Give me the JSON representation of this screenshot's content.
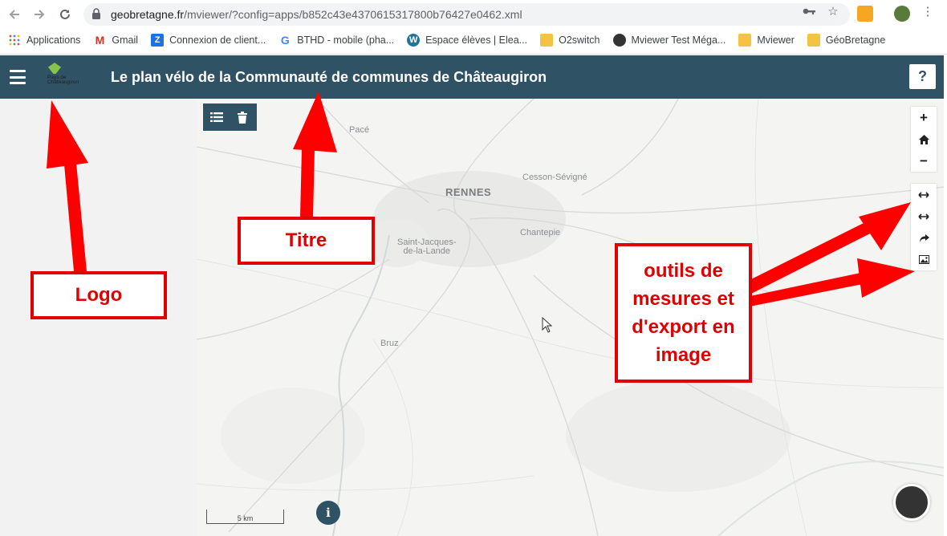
{
  "browser": {
    "url_host": "geobretagne.fr",
    "url_path": "/mviewer/?config=apps/b852c43e4370615317800b76427e0462.xml",
    "bookmarks": [
      {
        "label": "Applications",
        "icon": "apps-grid-icon",
        "color": "#4285f4"
      },
      {
        "label": "Gmail",
        "icon": "gmail-icon",
        "color": "#d93025"
      },
      {
        "label": "Connexion de client...",
        "icon": "z-icon",
        "color": "#1a73e8"
      },
      {
        "label": "BTHD - mobile (pha...",
        "icon": "g-icon",
        "color": "#4285f4"
      },
      {
        "label": "Espace élèves | Elea...",
        "icon": "wordpress-icon",
        "color": "#21759b"
      },
      {
        "label": "O2switch",
        "icon": "folder-icon",
        "color": "#f6c244"
      },
      {
        "label": "Mviewer Test Méga...",
        "icon": "globe-icon",
        "color": "#333333"
      },
      {
        "label": "Mviewer",
        "icon": "folder-icon",
        "color": "#f6c244"
      },
      {
        "label": "GéoBretagne",
        "icon": "folder-icon",
        "color": "#f6c244"
      }
    ]
  },
  "app": {
    "title": "Le plan vélo de la Communauté de communes de Châteaugiron",
    "logo_text": "Pays de Châteaugiron",
    "help_label": "?",
    "header_color": "#2f5265"
  },
  "map": {
    "places": {
      "pace": "Pacé",
      "rennes": "RENNES",
      "cesson": "Cesson-Sévigné",
      "saint_jacques": "Saint-Jacques-\nde-la-Lande",
      "chantepie": "Chantepie",
      "bruz": "Bruz"
    },
    "scale_label": "5 km",
    "info_label": "i",
    "zoom_in": "+",
    "zoom_out": "−"
  },
  "annotations": {
    "logo": "Logo",
    "titre": "Titre",
    "outils": "outils de mesures et d'export en image",
    "color": "#e00000"
  }
}
